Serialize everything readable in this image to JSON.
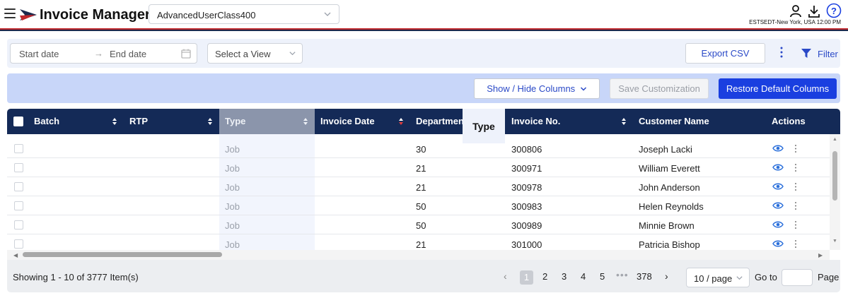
{
  "header": {
    "app_title": "Invoice Manager",
    "user_class": "AdvancedUserClass400",
    "timezone_text": "ESTSEDT-New York, USA 12:00 PM",
    "icons": [
      "menu-icon",
      "user-icon",
      "download-icon",
      "help-icon"
    ],
    "brand_colors": {
      "red": "#c0282d",
      "navy": "#1b2a4e"
    }
  },
  "filters": {
    "start_placeholder": "Start date",
    "end_placeholder": "End date",
    "view_placeholder": "Select a View",
    "export_label": "Export CSV",
    "filter_label": "Filter"
  },
  "customization": {
    "show_hide_label": "Show / Hide Columns",
    "save_label": "Save Customization",
    "restore_label": "Restore Default Columns"
  },
  "table": {
    "columns": [
      "Batch",
      "RTP",
      "Type",
      "Invoice Date",
      "Department",
      "Invoice No.",
      "Customer Name",
      "Actions"
    ],
    "drag_label": "Type",
    "rows": [
      {
        "type": "Job",
        "department": "30",
        "invoice_no": "300806",
        "customer": "Joseph Lacki"
      },
      {
        "type": "Job",
        "department": "21",
        "invoice_no": "300971",
        "customer": "William Everett"
      },
      {
        "type": "Job",
        "department": "21",
        "invoice_no": "300978",
        "customer": "John Anderson"
      },
      {
        "type": "Job",
        "department": "50",
        "invoice_no": "300983",
        "customer": "Helen Reynolds"
      },
      {
        "type": "Job",
        "department": "50",
        "invoice_no": "300989",
        "customer": "Minnie Brown"
      },
      {
        "type": "Job",
        "department": "21",
        "invoice_no": "301000",
        "customer": "Patricia Bishop"
      }
    ]
  },
  "pagination": {
    "showing": "Showing 1 - 10 of 3777 Item(s)",
    "pages": [
      "1",
      "2",
      "3",
      "4",
      "5",
      "378"
    ],
    "ellipsis": "•••",
    "prev": "‹",
    "next": "›",
    "page_size": "10 / page",
    "goto_label": "Go to",
    "page_label": "Page"
  },
  "colors": {
    "accent": "#1a3fe0",
    "header": "#142a57",
    "link": "#2a49c7"
  }
}
